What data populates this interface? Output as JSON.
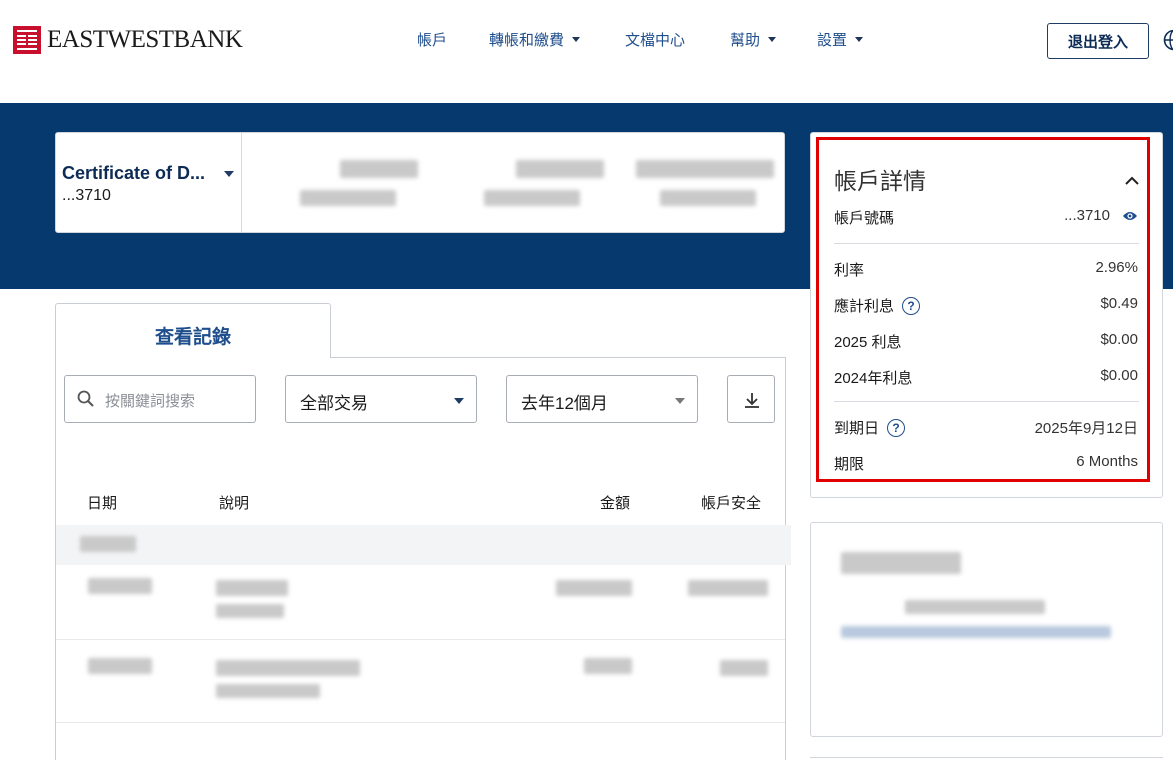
{
  "brand": {
    "name": "EASTWESTBANK",
    "color": "#c8102e"
  },
  "nav": {
    "items": [
      {
        "label": "帳戶",
        "dropdown": false
      },
      {
        "label": "轉帳和繳費",
        "dropdown": true
      },
      {
        "label": "文檔中心",
        "dropdown": false
      },
      {
        "label": "幫助",
        "dropdown": true
      },
      {
        "label": "設置",
        "dropdown": true
      }
    ],
    "logout_label": "退出登入"
  },
  "account_selector": {
    "name": "Certificate of D...",
    "number": "...3710"
  },
  "tabs": [
    {
      "label": "查看記錄",
      "active": true
    }
  ],
  "filters": {
    "search_placeholder": "按關鍵詞搜索",
    "type_selected": "全部交易",
    "range_selected": "去年12個月"
  },
  "table": {
    "headers": [
      "日期",
      "說明",
      "金額",
      "帳戶安全"
    ]
  },
  "account_details": {
    "title": "帳戶詳情",
    "account_number_label": "帳戶號碼",
    "account_number_value": "...3710",
    "rows": [
      {
        "label": "利率",
        "value": "2.96%",
        "help": false
      },
      {
        "label": "應計利息",
        "value": "$0.49",
        "help": true
      },
      {
        "label": "2025 利息",
        "value": "$0.00",
        "help": false
      },
      {
        "label": "2024年利息",
        "value": "$0.00",
        "help": false
      }
    ],
    "maturity_label": "到期日",
    "maturity_value": "2025年9月12日",
    "term_label": "期限",
    "term_value": "6 Months"
  },
  "colors": {
    "navy": "#063a6e",
    "link": "#1f4e8c",
    "highlight": "#e00000"
  }
}
